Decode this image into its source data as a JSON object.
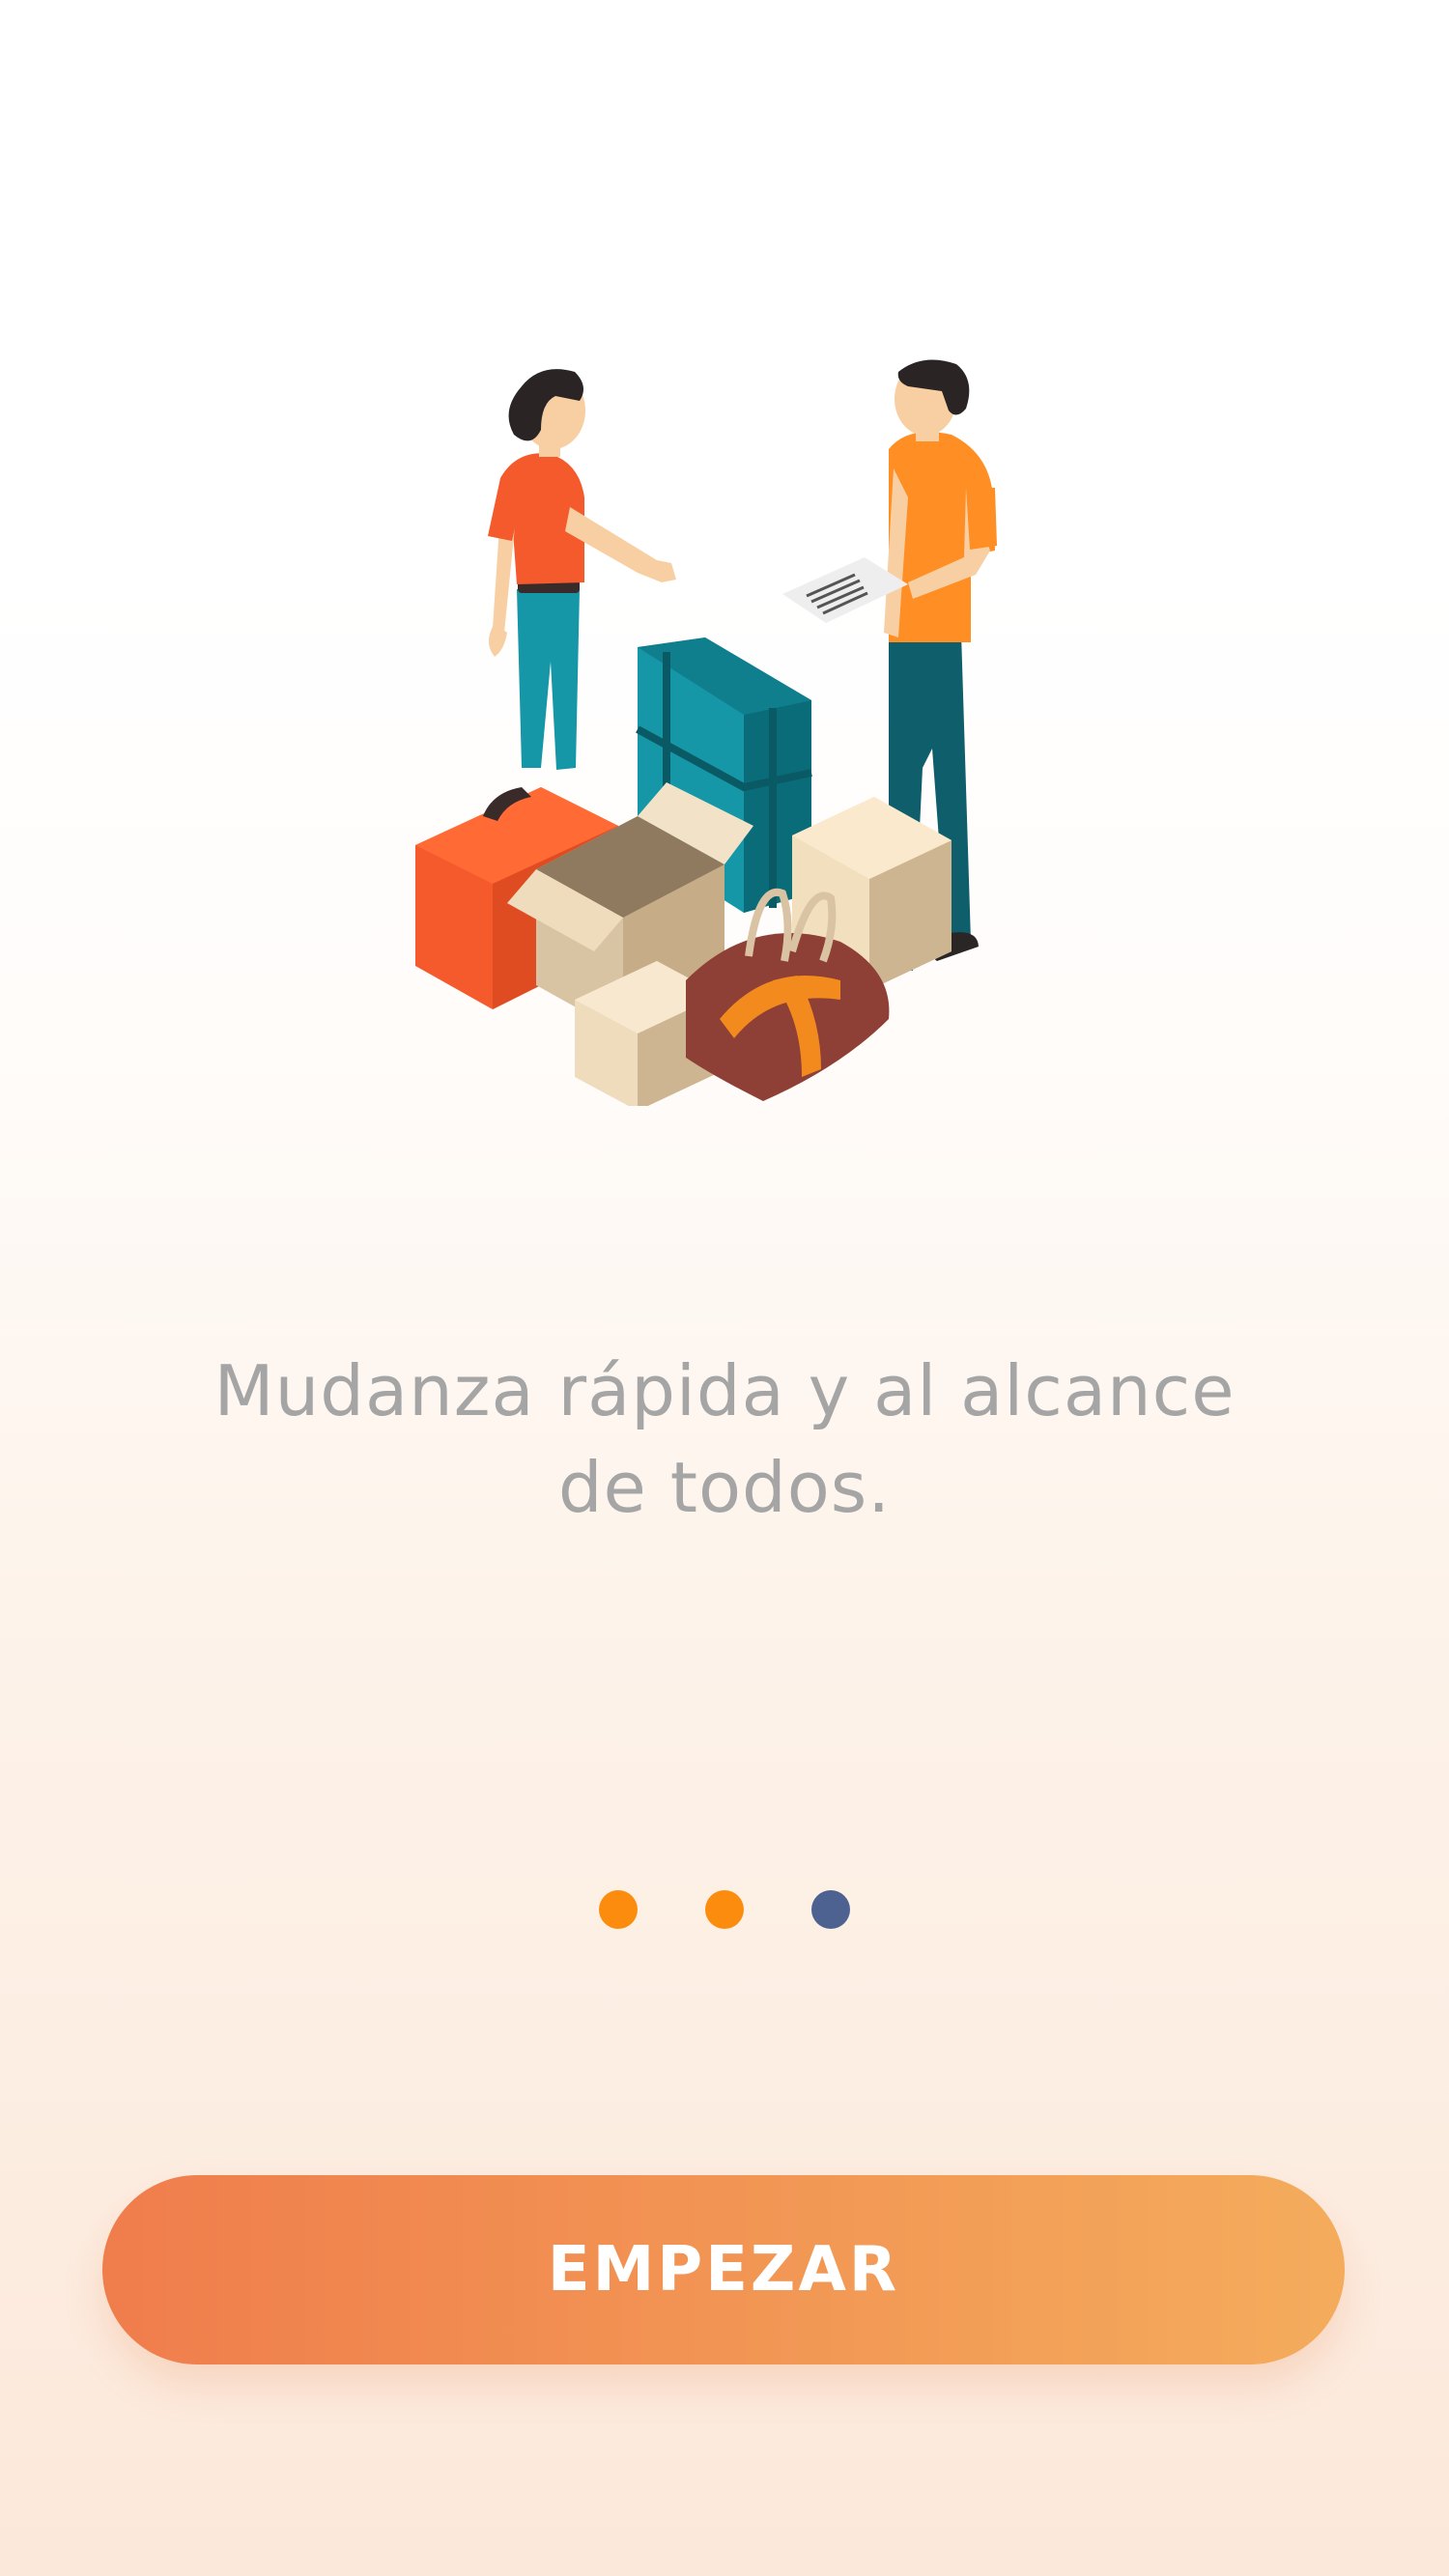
{
  "onboarding": {
    "illustration_name": "moving-people-luggage-illustration",
    "tagline_line1": "Mudanza rápida y al alcance",
    "tagline_line2": "de todos.",
    "pager": {
      "total": 3,
      "active_index": 2,
      "dot_colors": [
        "#fb8c0e",
        "#fb8c0e",
        "#4e6291"
      ]
    },
    "button": {
      "label": "EMPEZAR",
      "gradient_start": "#f07d4c",
      "gradient_end": "#f4ac5c"
    }
  }
}
